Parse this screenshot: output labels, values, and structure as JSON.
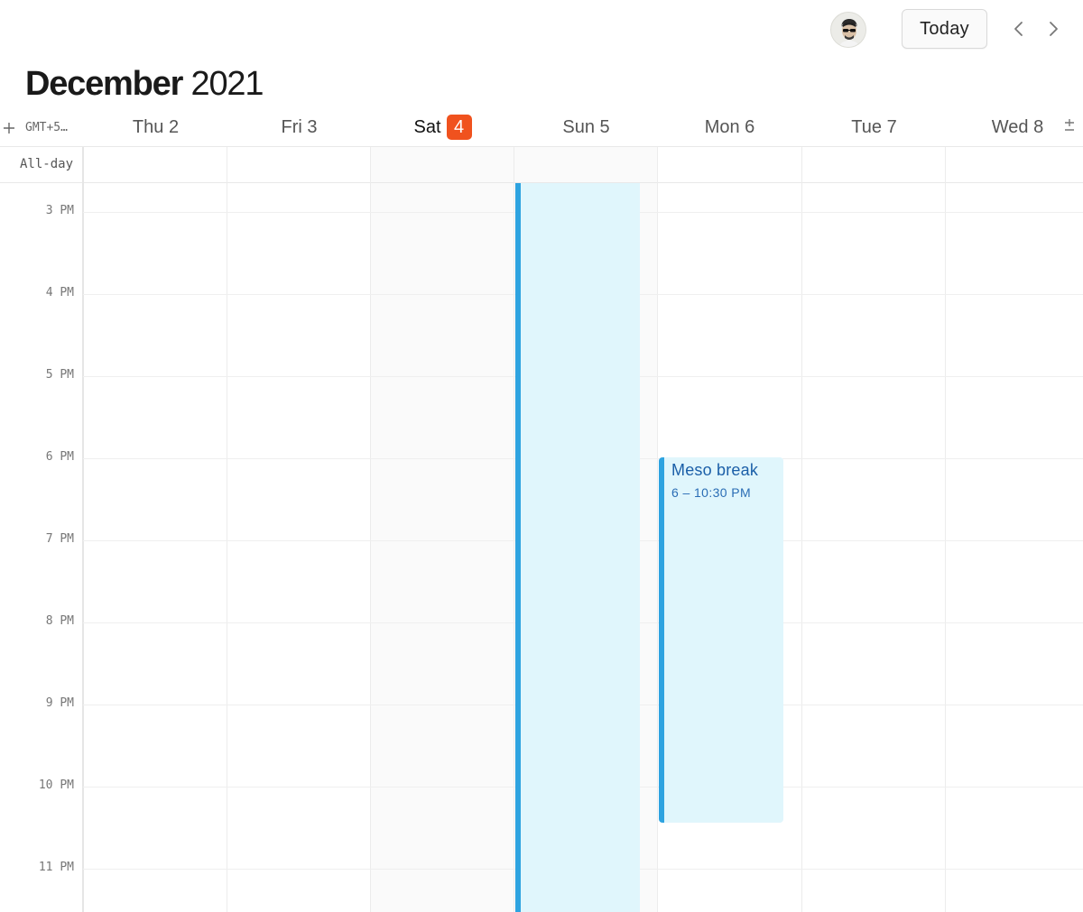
{
  "header": {
    "today_label": "Today",
    "month_name": "December",
    "year": "2021",
    "timezone_label": "GMT+5…"
  },
  "days": [
    {
      "name": "Thu",
      "num": "2"
    },
    {
      "name": "Fri",
      "num": "3"
    },
    {
      "name": "Sat",
      "num": "4",
      "today": true
    },
    {
      "name": "Sun",
      "num": "5"
    },
    {
      "name": "Mon",
      "num": "6"
    },
    {
      "name": "Tue",
      "num": "7"
    },
    {
      "name": "Wed",
      "num": "8"
    }
  ],
  "allday_label": "All-day",
  "hours": [
    "3 PM",
    "4 PM",
    "5 PM",
    "6 PM",
    "7 PM",
    "8 PM",
    "9 PM",
    "10 PM",
    "11 PM"
  ],
  "events": [
    {
      "title": "Meso break",
      "time": "6 – 10:30 PM",
      "day": "Mon 6"
    }
  ],
  "colors": {
    "today_badge": "#f0521e",
    "event_bg": "#e0f6fc",
    "event_bar": "#2ea3e0",
    "event_text": "#1b5fa8"
  },
  "icons": {
    "add": "plus-icon",
    "prev": "chevron-left-icon",
    "next": "chevron-right-icon",
    "zoom": "plus-minus-icon",
    "avatar": "user-avatar"
  }
}
